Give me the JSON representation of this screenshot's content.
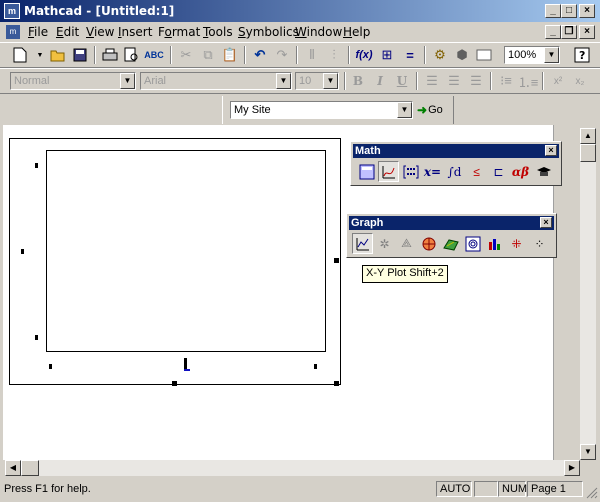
{
  "window": {
    "title": "Mathcad - [Untitled:1]"
  },
  "menu": [
    {
      "label": "File",
      "key": "F",
      "rest": "ile"
    },
    {
      "label": "Edit",
      "key": "E",
      "rest": "dit"
    },
    {
      "label": "View",
      "key": "V",
      "rest": "iew"
    },
    {
      "label": "Insert",
      "key": "I",
      "rest": "nsert"
    },
    {
      "label": "Format",
      "key": "o",
      "pre": "F",
      "rest": "rmat"
    },
    {
      "label": "Tools",
      "key": "T",
      "rest": "ools"
    },
    {
      "label": "Symbolics",
      "key": "S",
      "rest": "ymbolics"
    },
    {
      "label": "Window",
      "key": "W",
      "rest": "indow"
    },
    {
      "label": "Help",
      "key": "H",
      "rest": "elp"
    }
  ],
  "toolbar": {
    "zoom": "100%"
  },
  "format_bar": {
    "style": "Normal",
    "font": "Arial",
    "size": "10",
    "bold": "B",
    "italic": "I",
    "underline": "U",
    "superscript": "x²",
    "subscript": "x₂"
  },
  "web_bar": {
    "address": "My Site",
    "go_label": "Go"
  },
  "math_palette": {
    "title": "Math",
    "buttons": [
      "calculator-icon",
      "graph-icon",
      "matrix-icon",
      "evaluation-icon",
      "calculus-icon",
      "boolean-icon",
      "programming-icon",
      "greek-icon",
      "symbolic-icon"
    ],
    "evaluation_label": "x=",
    "greek_label": "αβ"
  },
  "graph_palette": {
    "title": "Graph",
    "buttons": [
      "xy-plot-icon",
      "polar-plot-icon",
      "surface-plot-icon",
      "contour-plot-icon",
      "3d-scatter-icon",
      "3d-bar-icon",
      "vector-field-icon",
      "trace-icon",
      "zoom-icon"
    ]
  },
  "tooltip": "X-Y Plot Shift+2",
  "status": {
    "help": "Press F1 for help.",
    "mode": "AUTO",
    "num": "NUM",
    "page": "Page 1"
  }
}
